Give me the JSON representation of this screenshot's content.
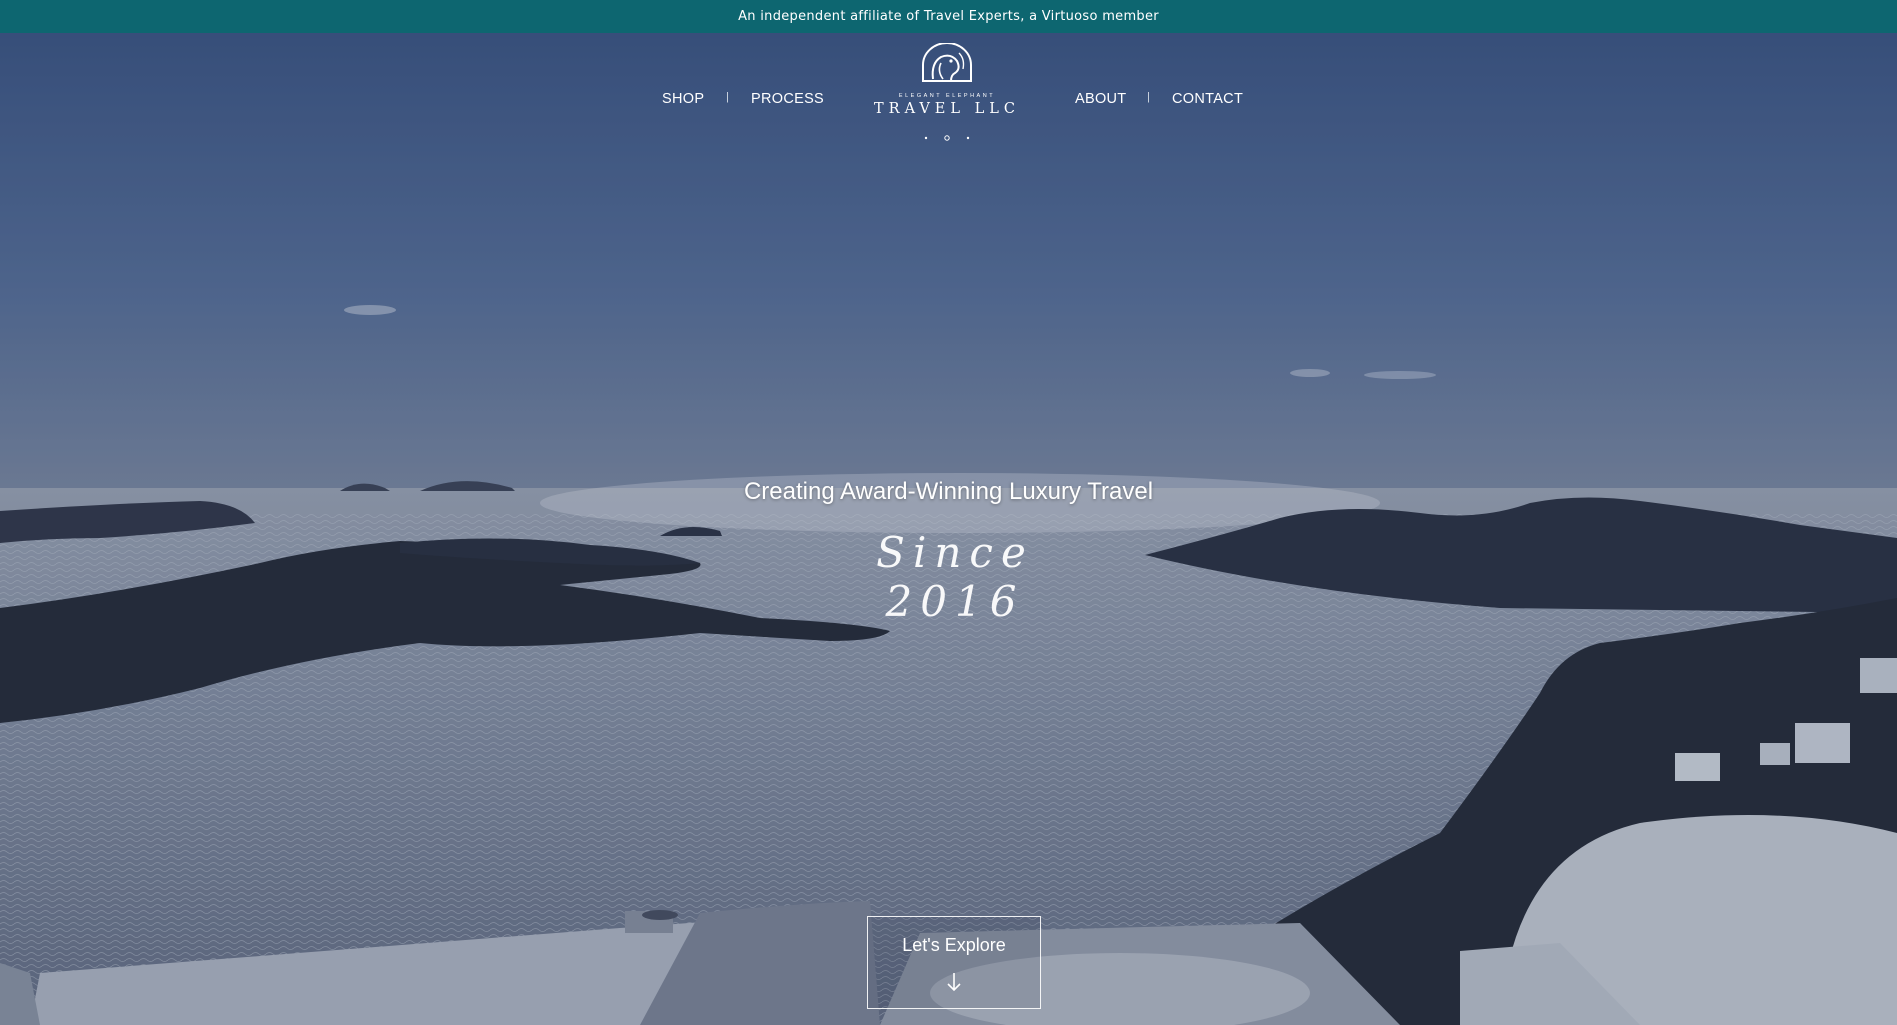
{
  "topbar": {
    "text": "An independent affiliate of Travel Experts, a Virtuoso member"
  },
  "nav": {
    "left": [
      {
        "label": "SHOP"
      },
      {
        "label": "PROCESS"
      }
    ],
    "right": [
      {
        "label": "ABOUT"
      },
      {
        "label": "CONTACT"
      }
    ],
    "separator": "|"
  },
  "logo": {
    "line1": "ELEGANT ELEPHANT",
    "line2": "TRAVEL LLC"
  },
  "hero": {
    "headline": "Creating Award-Winning Luxury Travel",
    "script": "Since 2016",
    "cta_label": "Let's Explore"
  },
  "icons": {
    "cta": "arrow-down-icon",
    "logo": "elephant-logo-icon"
  },
  "colors": {
    "topbar": "#0d6670",
    "sky": "#3e5880",
    "sea": "#8f9aab"
  }
}
